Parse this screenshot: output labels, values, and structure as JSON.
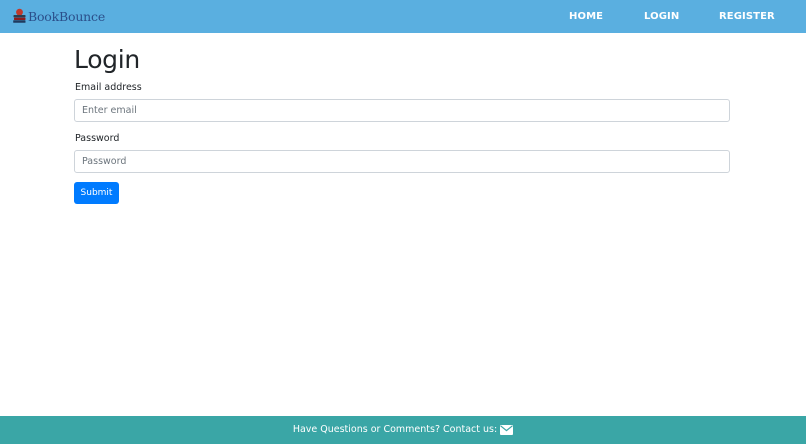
{
  "navbar": {
    "brand": "BookBounce",
    "links": {
      "home": "HOME",
      "login": "LOGIN",
      "register": "REGISTER"
    }
  },
  "main": {
    "title": "Login",
    "email": {
      "label": "Email address",
      "placeholder": "Enter email",
      "value": ""
    },
    "password": {
      "label": "Password",
      "placeholder": "Password",
      "value": ""
    },
    "submit_label": "Submit"
  },
  "footer": {
    "text": "Have Questions or Comments? Contact us:",
    "icon": "envelope-icon"
  },
  "colors": {
    "navbar_bg": "#5aafe0",
    "footer_bg": "#3aa6a6",
    "button_bg": "#007bff",
    "brand_text": "#2b4f8a"
  }
}
